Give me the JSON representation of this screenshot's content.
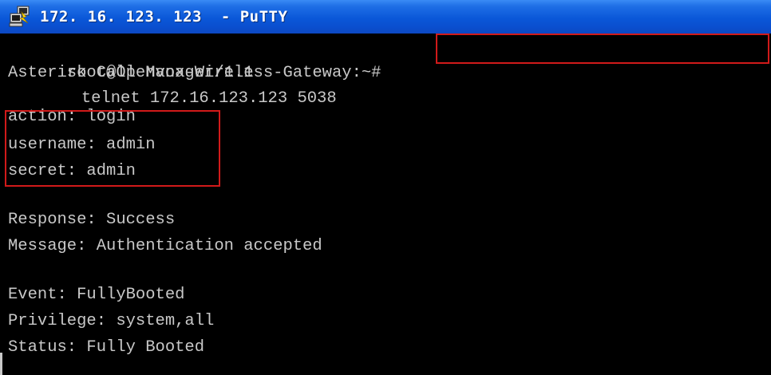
{
  "window": {
    "title": "172. 16. 123. 123  - PuTTY",
    "icon": "putty-icon"
  },
  "terminal": {
    "prompt": "root@Openvox-Wireless-Gateway:~#",
    "command": "telnet 172.16.123.123 5038",
    "lines": [
      "Asterisk Call Manager/1.1",
      "action: login",
      "username: admin",
      "secret: admin",
      "",
      "Response: Success",
      "Message: Authentication accepted",
      "",
      "Event: FullyBooted",
      "Privilege: system,all",
      "Status: Fully Booted"
    ],
    "colors": {
      "foreground": "#c8c8c8",
      "background": "#000000",
      "highlight": "#d11a1a"
    }
  }
}
